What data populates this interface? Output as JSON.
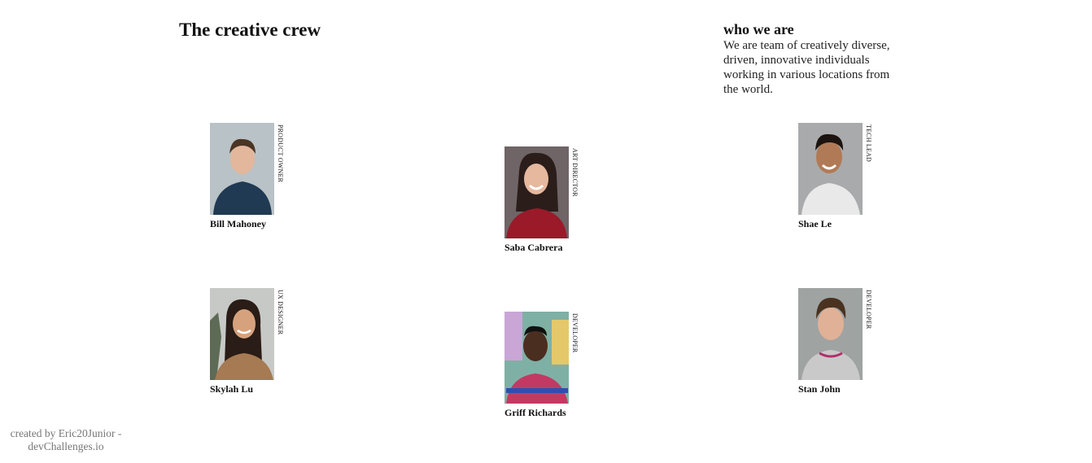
{
  "header": {
    "title": "The creative crew"
  },
  "about": {
    "heading": "who we are",
    "text": "We are team of creatively diverse, driven, innovative individuals working in various locations from the world."
  },
  "members": [
    {
      "name": "Bill Mahoney",
      "role": "PRODUCT OWNER",
      "photo_bg": "#b9c2c6",
      "photo_fg": "#1f3a52"
    },
    {
      "name": "Saba Cabrera",
      "role": "ART DIRECTOR",
      "photo_bg": "#6f6466",
      "photo_fg": "#9a1a2a"
    },
    {
      "name": "Shae Le",
      "role": "TECH LEAD",
      "photo_bg": "#a9aaab",
      "photo_fg": "#e9e9ea"
    },
    {
      "name": "Skylah Lu",
      "role": "UX DESIGNER",
      "photo_bg": "#c7c9c6",
      "photo_fg": "#a67a52"
    },
    {
      "name": "Griff Richards",
      "role": "DEVELOPER",
      "photo_bg": "#7fb0a5",
      "photo_fg": "#c23a64"
    },
    {
      "name": "Stan John",
      "role": "DEVELOPER",
      "photo_bg": "#9fa3a2",
      "photo_fg": "#c9c9c9"
    }
  ],
  "footer": {
    "text": "created by Eric20Junior - devChallenges.io"
  }
}
